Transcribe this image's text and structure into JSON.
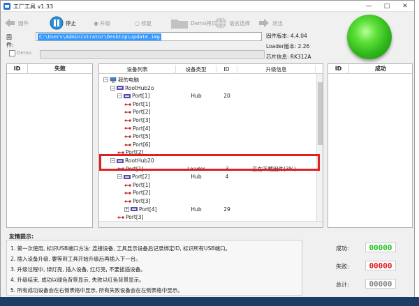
{
  "window": {
    "title": "工厂工具 v1.33",
    "controls": [
      "—",
      "□",
      "✕"
    ]
  },
  "toolbar": {
    "firmware_label": "固件",
    "stop_label": "停止",
    "upgrade_label": "升级",
    "repair_label": "修复",
    "switch_label": "Demo拷贝",
    "language_label": "语言选择",
    "exit_label": "退出"
  },
  "firmware": {
    "label": "固件:",
    "path": "C:\\Users\\Administrator\\Desktop\\update.img"
  },
  "info": {
    "fw_version": "固件版本: 4.4.04",
    "loader_version": "Loader版本: 2.26",
    "chip_info": "芯片信息: RK312A"
  },
  "demo": {
    "label": "Demo"
  },
  "fail_panel": {
    "id_header": "ID",
    "title": "失败"
  },
  "success_panel": {
    "id_header": "ID",
    "title": "成功"
  },
  "device_table": {
    "headers": [
      "设备列表",
      "设备类型",
      "ID",
      "升级信息"
    ],
    "rows": [
      {
        "name": "我的电脑",
        "type": "",
        "id": "",
        "info": "",
        "level": 0,
        "icon": "computer-icon",
        "expander": "−"
      },
      {
        "name": "RootHub2o",
        "type": "",
        "id": "",
        "info": "",
        "level": 1,
        "icon": "usb-hub-icon",
        "expander": "−"
      },
      {
        "name": "Port[1]",
        "type": "Hub",
        "id": "20",
        "info": "",
        "level": 2,
        "icon": "usb-hub-icon",
        "expander": "−"
      },
      {
        "name": "Port[1]",
        "type": "",
        "id": "",
        "info": "",
        "level": 3,
        "icon": "usb-port-icon",
        "expander": ""
      },
      {
        "name": "Port[2]",
        "type": "",
        "id": "",
        "info": "",
        "level": 3,
        "icon": "usb-port-icon",
        "expander": ""
      },
      {
        "name": "Port[3]",
        "type": "",
        "id": "",
        "info": "",
        "level": 3,
        "icon": "usb-port-icon",
        "expander": ""
      },
      {
        "name": "Port[4]",
        "type": "",
        "id": "",
        "info": "",
        "level": 3,
        "icon": "usb-port-icon",
        "expander": ""
      },
      {
        "name": "Port[5]",
        "type": "",
        "id": "",
        "info": "",
        "level": 3,
        "icon": "usb-port-icon",
        "expander": ""
      },
      {
        "name": "Port[6]",
        "type": "",
        "id": "",
        "info": "",
        "level": 3,
        "icon": "usb-port-icon",
        "expander": ""
      },
      {
        "name": "Port[2]",
        "type": "",
        "id": "",
        "info": "",
        "level": 2,
        "icon": "usb-port-icon",
        "expander": ""
      },
      {
        "name": "RootHub20",
        "type": "",
        "id": "",
        "info": "",
        "level": 1,
        "icon": "usb-hub-icon",
        "expander": "−"
      },
      {
        "name": "Port[1]",
        "type": "Loader",
        "id": "3",
        "info": "正在下载固件(3%)...",
        "level": 2,
        "icon": "usb-active-icon",
        "expander": ""
      },
      {
        "name": "Port[2]",
        "type": "Hub",
        "id": "4",
        "info": "",
        "level": 2,
        "icon": "usb-hub-icon",
        "expander": "−"
      },
      {
        "name": "Port[1]",
        "type": "",
        "id": "",
        "info": "",
        "level": 3,
        "icon": "usb-port-icon",
        "expander": ""
      },
      {
        "name": "Port[2]",
        "type": "",
        "id": "",
        "info": "",
        "level": 3,
        "icon": "usb-port-icon",
        "expander": ""
      },
      {
        "name": "Port[3]",
        "type": "",
        "id": "",
        "info": "",
        "level": 3,
        "icon": "usb-port-icon",
        "expander": ""
      },
      {
        "name": "Port[4]",
        "type": "Hub",
        "id": "29",
        "info": "",
        "level": 3,
        "icon": "usb-hub-icon",
        "expander": "+"
      },
      {
        "name": "Port[3]",
        "type": "",
        "id": "",
        "info": "",
        "level": 2,
        "icon": "usb-port-icon",
        "expander": ""
      }
    ]
  },
  "tips": {
    "title": "友情提示:",
    "items": [
      "1. 第一次使用, 标识USB端口方法: 连接设备, 工具显示设备后记录绑定ID, 标识所有USB端口。",
      "2. 插入设备升级, 要等到工具开始升级后再插入下一台。",
      "3. 升级过程中, 绿灯亮, 插入设备, 红灯亮, 不要拔插设备。",
      "4. 升级结束, 成功以绿色背景显示, 失败以红色背景显示。",
      "5. 所有成功设备会在右侧表格中显示, 所有失败设备会在左侧表格中显示。"
    ]
  },
  "stats": [
    {
      "label": "成功:",
      "value": "00000",
      "color": "#22c322"
    },
    {
      "label": "失败:",
      "value": "00000",
      "color": "#e01f1f"
    },
    {
      "label": "总计:",
      "value": "00000",
      "color": "#8a8a8a"
    }
  ],
  "colors": {
    "main_button": "#3cc322",
    "highlight": "#e02020",
    "selection": "#3399ff"
  }
}
